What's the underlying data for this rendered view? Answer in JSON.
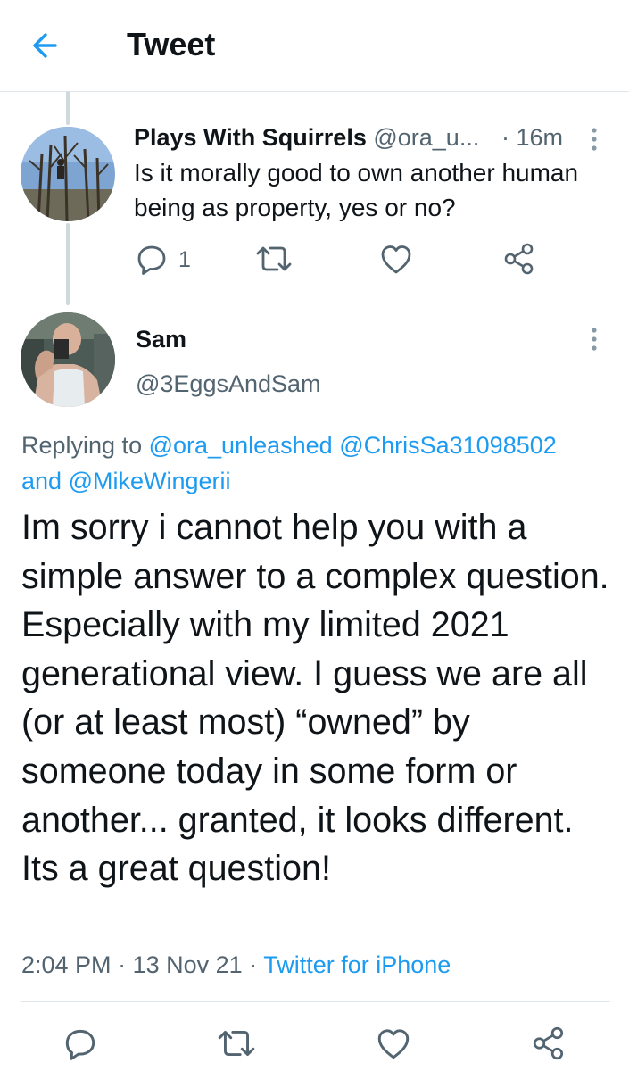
{
  "header": {
    "title": "Tweet"
  },
  "parent_tweet": {
    "name": "Plays With Squirrels",
    "handle": "@ora_u...",
    "separator": "·",
    "time": "16m",
    "text": "Is it morally good to own another human being as property, yes or no?",
    "reply_count": "1"
  },
  "main_tweet": {
    "name": "Sam",
    "handle": "@3EggsAndSam",
    "replying_prefix": "Replying to",
    "mention_1": "@ora_unleashed",
    "mention_2": "@ChrisSa31098502",
    "and_word": "and",
    "mention_3": "@MikeWingerii",
    "text": "Im sorry i cannot help you with a simple answer to a complex question.  Especially with my limited 2021 generational view.  I guess we are all (or at least most) “owned” by someone today in some form or another... granted, it looks different.  Its a great question!",
    "time": "2:04 PM",
    "dot": "·",
    "date": "13 Nov 21",
    "source": "Twitter for iPhone"
  },
  "colors": {
    "accent": "#1d9bf0",
    "secondary_text": "#536471",
    "icon": "#536471"
  },
  "icons": [
    "back-arrow-icon",
    "more-icon",
    "reply-icon",
    "retweet-icon",
    "like-icon",
    "share-icon"
  ]
}
